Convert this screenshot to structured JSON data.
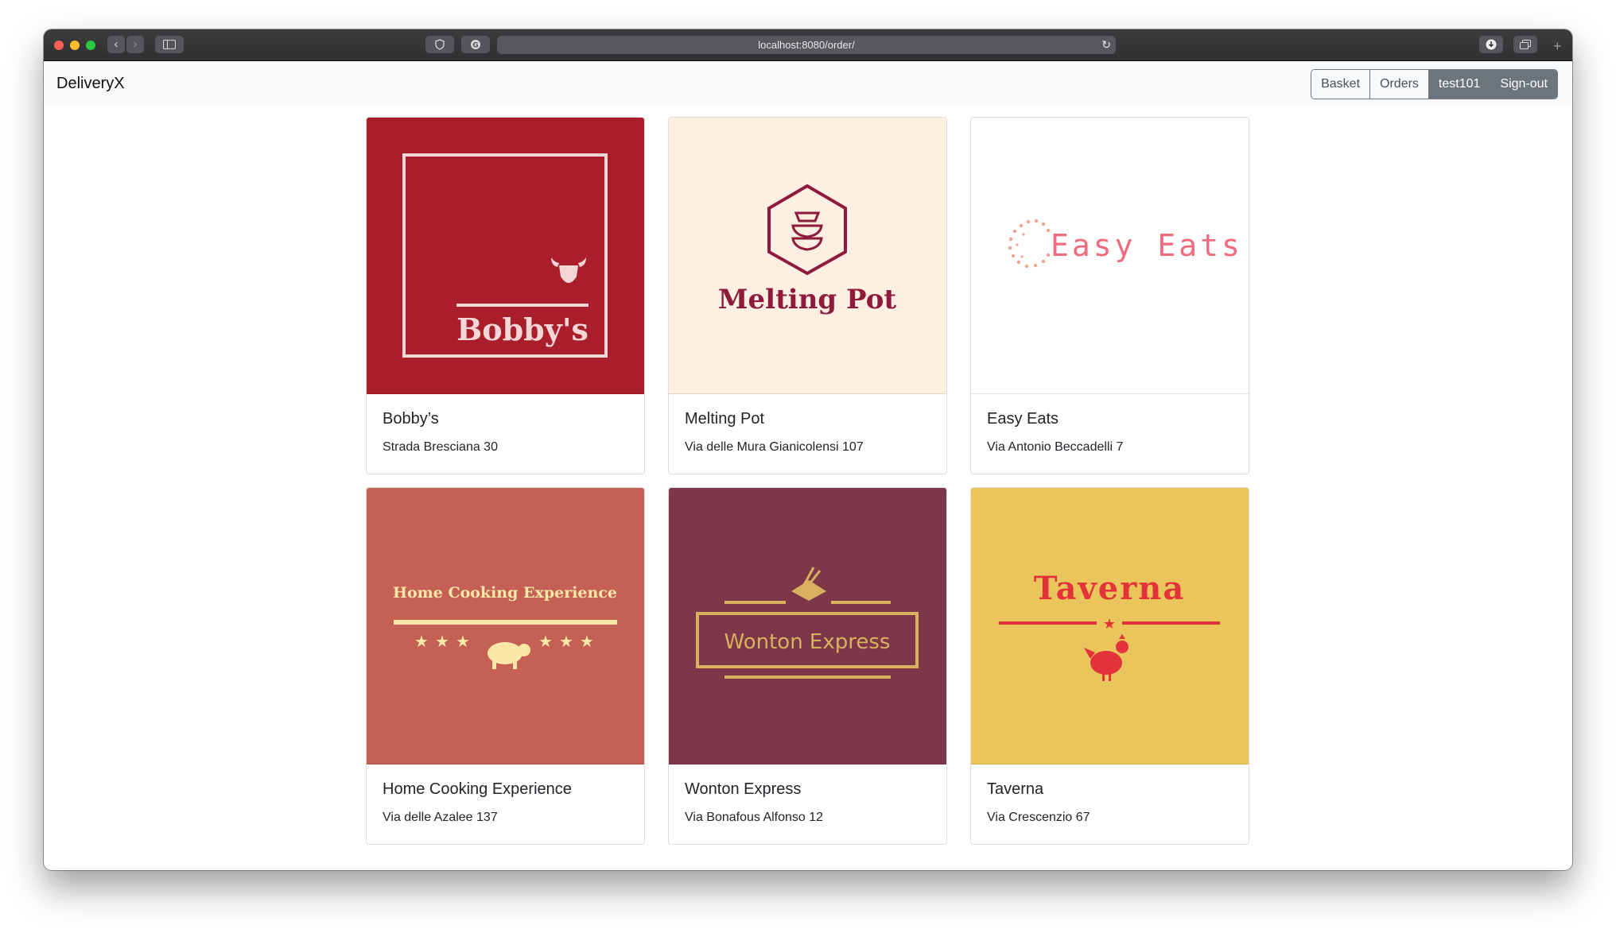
{
  "browser": {
    "url": "localhost:8080/order/"
  },
  "navbar": {
    "brand": "DeliveryX",
    "buttons": {
      "basket": "Basket",
      "orders": "Orders",
      "user": "test101",
      "signout": "Sign-out"
    }
  },
  "restaurants": [
    {
      "name": "Bobby’s",
      "address": "Strada Bresciana 30",
      "logo_text": "Bobby's",
      "bg": "#a91e2a"
    },
    {
      "name": "Melting Pot",
      "address": "Via delle Mura Gianicolensi 107",
      "logo_text": "Melting Pot",
      "bg": "#fdefe2"
    },
    {
      "name": "Easy Eats",
      "address": "Via Antonio Beccadelli 7",
      "logo_text": "Easy Eats",
      "bg": "#ffffff"
    },
    {
      "name": "Home Cooking Experience",
      "address": "Via delle Azalee 137",
      "logo_text": "Home Cooking Experience",
      "bg": "#c46054"
    },
    {
      "name": "Wonton Express",
      "address": "Via Bonafous Alfonso 12",
      "logo_text": "Wonton Express",
      "bg": "#7c3848"
    },
    {
      "name": "Taverna",
      "address": "Via Crescenzio 67",
      "logo_text": "Taverna",
      "bg": "#e9c55c"
    }
  ]
}
